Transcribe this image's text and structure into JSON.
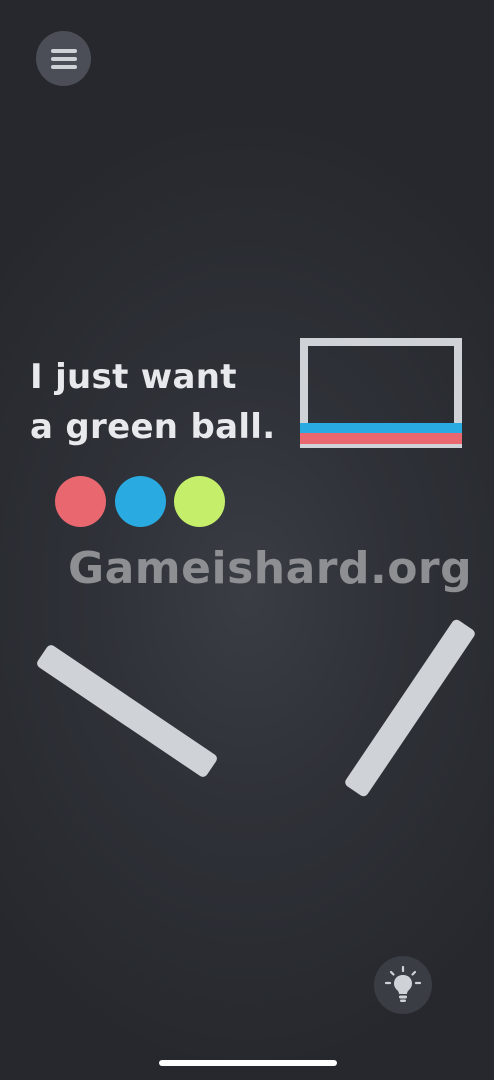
{
  "menu": {
    "icon": "hamburger-menu-icon"
  },
  "puzzle": {
    "line1": "I just want",
    "line2": "a green ball."
  },
  "balls": [
    {
      "color": "#e96870",
      "name": "red"
    },
    {
      "color": "#29abe2",
      "name": "blue"
    },
    {
      "color": "#c5ef6a",
      "name": "green"
    }
  ],
  "box": {
    "frame_color": "#cfd2d6",
    "stripe_colors": [
      "#29abe2",
      "#e96870"
    ]
  },
  "watermark": {
    "text": "Gameishard.org"
  },
  "hint": {
    "icon": "lightbulb-icon"
  },
  "colors": {
    "background": "#2e3137",
    "plank": "#cfd2d6",
    "text": "#e7e9ec"
  }
}
